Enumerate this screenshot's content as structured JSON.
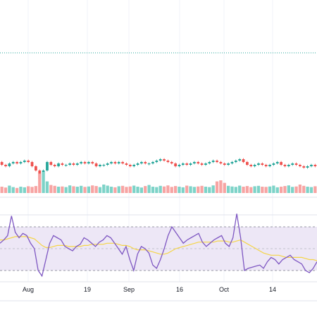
{
  "colors": {
    "up": "#26a69a",
    "down": "#ef5350",
    "volume_up": "#7dd3c8",
    "volume_down": "#f7a4a3",
    "rsi_line": "#7e57c2",
    "rsi_ma": "#f5d547",
    "rsi_band": "#ede7f6",
    "grid": "#f0f3fa",
    "dotted_level": "#26a69a"
  },
  "chart_data": [
    {
      "type": "candlestick",
      "title": "",
      "x_tick_labels": [
        "Aug",
        "19",
        "Sep",
        "16",
        "Oct",
        "14"
      ],
      "grid": true,
      "price_line_style": "dotted",
      "note": "Price panel: candles are tightly clustered with one large spike near early Aug; volume histogram beneath.",
      "candles": [
        {
          "i": 0,
          "o": 0.5,
          "c": 0.48
        },
        {
          "i": 1,
          "o": 0.48,
          "c": 0.47
        },
        {
          "i": 2,
          "o": 0.47,
          "c": 0.49
        },
        {
          "i": 3,
          "o": 0.49,
          "c": 0.5
        },
        {
          "i": 4,
          "o": 0.5,
          "c": 0.49
        },
        {
          "i": 5,
          "o": 0.49,
          "c": 0.5
        },
        {
          "i": 6,
          "o": 0.5,
          "c": 0.51
        },
        {
          "i": 7,
          "o": 0.51,
          "c": 0.5
        },
        {
          "i": 8,
          "o": 0.5,
          "c": 0.47
        },
        {
          "i": 9,
          "o": 0.47,
          "c": 0.44
        },
        {
          "i": 10,
          "o": 0.44,
          "c": 0.38
        },
        {
          "i": 11,
          "o": 0.38,
          "c": 0.44
        },
        {
          "i": 12,
          "o": 0.44,
          "c": 0.5
        },
        {
          "i": 13,
          "o": 0.5,
          "c": 0.48
        },
        {
          "i": 14,
          "o": 0.48,
          "c": 0.47
        },
        {
          "i": 15,
          "o": 0.47,
          "c": 0.49
        },
        {
          "i": 16,
          "o": 0.49,
          "c": 0.48
        },
        {
          "i": 17,
          "o": 0.48,
          "c": 0.48
        },
        {
          "i": 18,
          "o": 0.48,
          "c": 0.49
        },
        {
          "i": 19,
          "o": 0.49,
          "c": 0.48
        },
        {
          "i": 20,
          "o": 0.48,
          "c": 0.49
        },
        {
          "i": 21,
          "o": 0.49,
          "c": 0.5
        },
        {
          "i": 22,
          "o": 0.5,
          "c": 0.49
        },
        {
          "i": 23,
          "o": 0.49,
          "c": 0.5
        },
        {
          "i": 24,
          "o": 0.5,
          "c": 0.49
        },
        {
          "i": 25,
          "o": 0.49,
          "c": 0.47
        },
        {
          "i": 26,
          "o": 0.47,
          "c": 0.48
        },
        {
          "i": 27,
          "o": 0.48,
          "c": 0.48
        },
        {
          "i": 28,
          "o": 0.48,
          "c": 0.49
        },
        {
          "i": 29,
          "o": 0.49,
          "c": 0.5
        },
        {
          "i": 30,
          "o": 0.5,
          "c": 0.49
        },
        {
          "i": 31,
          "o": 0.49,
          "c": 0.5
        },
        {
          "i": 32,
          "o": 0.5,
          "c": 0.49
        },
        {
          "i": 33,
          "o": 0.49,
          "c": 0.48
        },
        {
          "i": 34,
          "o": 0.48,
          "c": 0.47
        },
        {
          "i": 35,
          "o": 0.47,
          "c": 0.48
        },
        {
          "i": 36,
          "o": 0.48,
          "c": 0.49
        },
        {
          "i": 37,
          "o": 0.49,
          "c": 0.5
        },
        {
          "i": 38,
          "o": 0.5,
          "c": 0.49
        },
        {
          "i": 39,
          "o": 0.49,
          "c": 0.49
        },
        {
          "i": 40,
          "o": 0.49,
          "c": 0.5
        },
        {
          "i": 41,
          "o": 0.5,
          "c": 0.51
        },
        {
          "i": 42,
          "o": 0.51,
          "c": 0.52
        },
        {
          "i": 43,
          "o": 0.52,
          "c": 0.51
        },
        {
          "i": 44,
          "o": 0.51,
          "c": 0.5
        },
        {
          "i": 45,
          "o": 0.5,
          "c": 0.49
        },
        {
          "i": 46,
          "o": 0.49,
          "c": 0.47
        },
        {
          "i": 47,
          "o": 0.47,
          "c": 0.48
        },
        {
          "i": 48,
          "o": 0.48,
          "c": 0.49
        },
        {
          "i": 49,
          "o": 0.49,
          "c": 0.48
        },
        {
          "i": 50,
          "o": 0.48,
          "c": 0.49
        },
        {
          "i": 51,
          "o": 0.49,
          "c": 0.5
        },
        {
          "i": 52,
          "o": 0.5,
          "c": 0.49
        },
        {
          "i": 53,
          "o": 0.49,
          "c": 0.48
        },
        {
          "i": 54,
          "o": 0.48,
          "c": 0.49
        },
        {
          "i": 55,
          "o": 0.49,
          "c": 0.5
        },
        {
          "i": 56,
          "o": 0.5,
          "c": 0.51
        },
        {
          "i": 57,
          "o": 0.51,
          "c": 0.5
        },
        {
          "i": 58,
          "o": 0.5,
          "c": 0.49
        },
        {
          "i": 59,
          "o": 0.49,
          "c": 0.48
        },
        {
          "i": 60,
          "o": 0.48,
          "c": 0.49
        },
        {
          "i": 61,
          "o": 0.49,
          "c": 0.5
        },
        {
          "i": 62,
          "o": 0.5,
          "c": 0.51
        },
        {
          "i": 63,
          "o": 0.51,
          "c": 0.52
        },
        {
          "i": 64,
          "o": 0.52,
          "c": 0.5
        },
        {
          "i": 65,
          "o": 0.5,
          "c": 0.48
        },
        {
          "i": 66,
          "o": 0.48,
          "c": 0.47
        },
        {
          "i": 67,
          "o": 0.47,
          "c": 0.48
        },
        {
          "i": 68,
          "o": 0.48,
          "c": 0.49
        },
        {
          "i": 69,
          "o": 0.49,
          "c": 0.48
        },
        {
          "i": 70,
          "o": 0.48,
          "c": 0.47
        },
        {
          "i": 71,
          "o": 0.47,
          "c": 0.48
        },
        {
          "i": 72,
          "o": 0.48,
          "c": 0.49
        },
        {
          "i": 73,
          "o": 0.49,
          "c": 0.5
        },
        {
          "i": 74,
          "o": 0.5,
          "c": 0.48
        },
        {
          "i": 75,
          "o": 0.48,
          "c": 0.47
        },
        {
          "i": 76,
          "o": 0.47,
          "c": 0.48
        },
        {
          "i": 77,
          "o": 0.48,
          "c": 0.49
        },
        {
          "i": 78,
          "o": 0.49,
          "c": 0.48
        },
        {
          "i": 79,
          "o": 0.48,
          "c": 0.47
        },
        {
          "i": 80,
          "o": 0.47,
          "c": 0.46
        },
        {
          "i": 81,
          "o": 0.46,
          "c": 0.47
        },
        {
          "i": 82,
          "o": 0.47,
          "c": 0.48
        },
        {
          "i": 83,
          "o": 0.48,
          "c": 0.47
        }
      ],
      "volume": [
        0.3,
        0.26,
        0.35,
        0.28,
        0.24,
        0.3,
        0.27,
        0.32,
        0.29,
        0.33,
        0.92,
        1.0,
        0.55,
        0.38,
        0.34,
        0.3,
        0.31,
        0.28,
        0.36,
        0.32,
        0.3,
        0.34,
        0.29,
        0.31,
        0.36,
        0.33,
        0.28,
        0.4,
        0.35,
        0.3,
        0.27,
        0.32,
        0.34,
        0.29,
        0.31,
        0.35,
        0.3,
        0.26,
        0.33,
        0.38,
        0.3,
        0.28,
        0.34,
        0.31,
        0.36,
        0.29,
        0.33,
        0.3,
        0.27,
        0.35,
        0.32,
        0.29,
        0.31,
        0.34,
        0.3,
        0.28,
        0.36,
        0.55,
        0.6,
        0.48,
        0.34,
        0.31,
        0.29,
        0.35,
        0.3,
        0.33,
        0.28,
        0.32,
        0.34,
        0.3,
        0.29,
        0.31,
        0.35,
        0.27,
        0.3,
        0.33,
        0.36,
        0.29,
        0.31,
        0.4,
        0.34,
        0.3,
        0.28,
        0.32
      ]
    },
    {
      "type": "line",
      "title": "",
      "note": "RSI panel with shaded band and two dashed guide levels; purple RSI line and yellow moving average.",
      "ylim": [
        0,
        100
      ],
      "guide_levels": [
        70,
        50,
        30
      ],
      "series": [
        {
          "values": [
            55,
            58,
            62,
            80,
            65,
            60,
            64,
            62,
            55,
            50,
            30,
            25,
            40,
            55,
            62,
            60,
            58,
            52,
            50,
            48,
            52,
            54,
            60,
            58,
            55,
            52,
            56,
            58,
            62,
            60,
            55,
            50,
            45,
            52,
            40,
            30,
            45,
            52,
            50,
            46,
            35,
            32,
            40,
            50,
            62,
            70,
            65,
            60,
            55,
            58,
            60,
            62,
            64,
            56,
            52,
            55,
            58,
            60,
            62,
            55,
            52,
            60,
            82,
            60,
            30,
            32,
            33,
            34,
            35,
            32,
            38,
            42,
            40,
            36,
            40,
            42,
            44,
            40,
            38,
            36,
            30,
            28,
            32,
            38
          ]
        },
        {
          "values": [
            58,
            58,
            59,
            60,
            61,
            61,
            61,
            61,
            60,
            59,
            56,
            53,
            51,
            51,
            52,
            53,
            53,
            53,
            52,
            52,
            52,
            52,
            53,
            53,
            54,
            54,
            54,
            54,
            55,
            55,
            55,
            54,
            53,
            53,
            52,
            50,
            49,
            49,
            49,
            48,
            47,
            46,
            45,
            45,
            46,
            48,
            50,
            51,
            52,
            53,
            54,
            55,
            56,
            56,
            56,
            56,
            56,
            57,
            57,
            57,
            56,
            56,
            57,
            58,
            56,
            54,
            52,
            50,
            48,
            46,
            45,
            44,
            44,
            44,
            43,
            42,
            42,
            42,
            42,
            42,
            41,
            40,
            40,
            39
          ]
        }
      ]
    }
  ]
}
